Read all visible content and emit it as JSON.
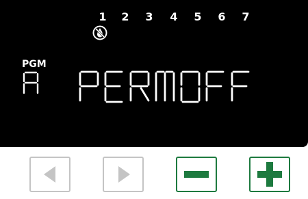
{
  "display": {
    "days": [
      "1",
      "2",
      "3",
      "4",
      "5",
      "6",
      "7"
    ],
    "pgm_label": "PGM",
    "program": "A",
    "status_text": "PERMOFF",
    "colors": {
      "lcd_background": "#000000",
      "segment": "#ffffff",
      "nav_button_border": "#c4c4c4",
      "nav_arrow": "#c4c4c4",
      "action_button": "#1d7a3f"
    },
    "icons": {
      "water_off": "no-water-drop-icon"
    }
  },
  "buttons": {
    "left": {
      "icon": "left-arrow-icon"
    },
    "right": {
      "icon": "right-arrow-icon"
    },
    "minus": {
      "icon": "minus-icon"
    },
    "plus": {
      "icon": "plus-icon"
    }
  }
}
